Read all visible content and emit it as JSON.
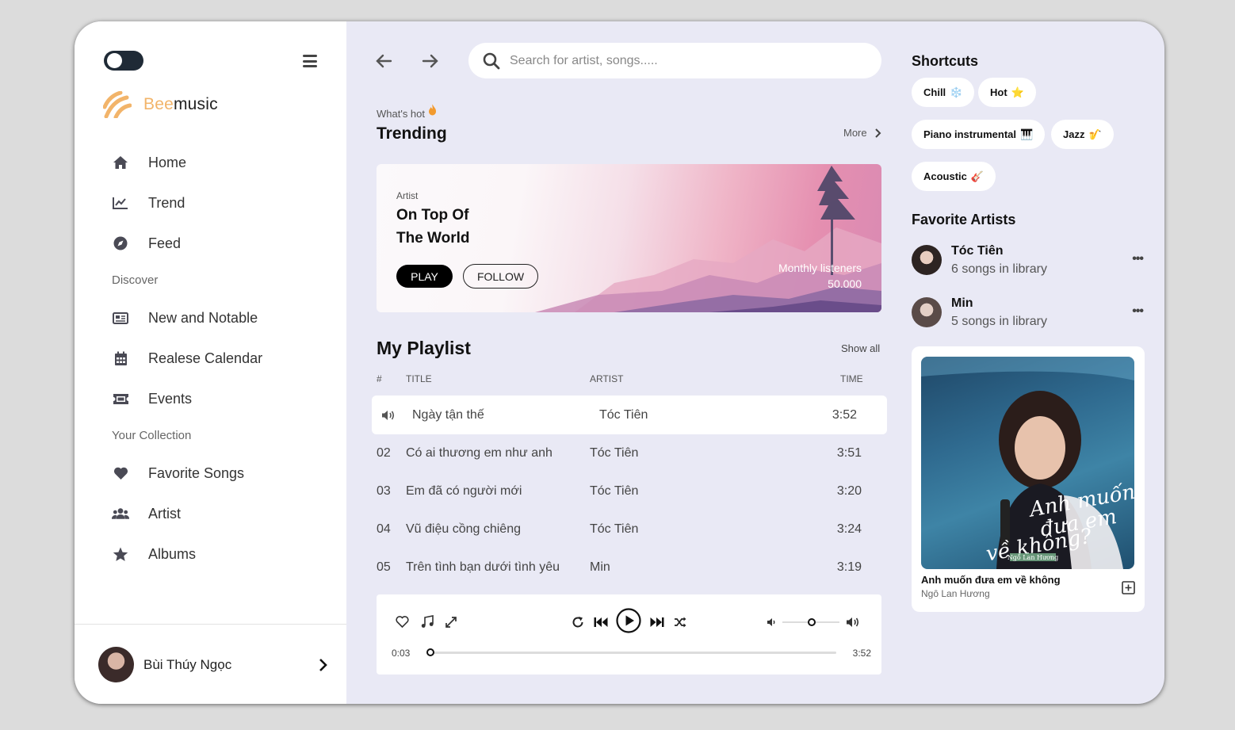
{
  "sidebar": {
    "logo": {
      "bee": "Bee",
      "music": "music"
    },
    "nav": [
      {
        "label": "Home",
        "icon": "home-icon"
      },
      {
        "label": "Trend",
        "icon": "chart-line-icon"
      },
      {
        "label": "Feed",
        "icon": "compass-icon"
      }
    ],
    "discover_label": "Discover",
    "discover": [
      {
        "label": "New and Notable",
        "icon": "newspaper-icon"
      },
      {
        "label": "Realese Calendar",
        "icon": "calendar-icon"
      },
      {
        "label": "Events",
        "icon": "ticket-icon"
      }
    ],
    "collection_label": "Your Collection",
    "collection": [
      {
        "label": "Favorite Songs",
        "icon": "heart-icon"
      },
      {
        "label": "Artist",
        "icon": "users-icon"
      },
      {
        "label": "Albums",
        "icon": "star-icon"
      }
    ],
    "user": {
      "name": "Bùi Thúy Ngọc"
    }
  },
  "search": {
    "placeholder": "Search for artist, songs....."
  },
  "trending": {
    "kicker": "What's hot",
    "title": "Trending",
    "more": "More",
    "hero": {
      "artist_label": "Artist",
      "title_line1": "On Top Of",
      "title_line2": "The World",
      "play": "PLAY",
      "follow": "FOLLOW",
      "listeners_label": "Monthly listeners",
      "listeners_value": "50.000"
    }
  },
  "playlist": {
    "title": "My Playlist",
    "show_all": "Show all",
    "headers": {
      "num": "#",
      "title": "TITLE",
      "artist": "ARTIST",
      "time": "TIME"
    },
    "rows": [
      {
        "num": "",
        "title": "Ngày tận thế",
        "artist": "Tóc Tiên",
        "time": "3:52",
        "playing": true
      },
      {
        "num": "02",
        "title": "Có ai thương em như anh",
        "artist": "Tóc Tiên",
        "time": "3:51"
      },
      {
        "num": "03",
        "title": "Em đã có người mới",
        "artist": "Tóc Tiên",
        "time": "3:20"
      },
      {
        "num": "04",
        "title": "Vũ điệu cồng chiêng",
        "artist": "Tóc Tiên",
        "time": "3:24"
      },
      {
        "num": "05",
        "title": "Trên tình bạn dưới tình yêu",
        "artist": "Min",
        "time": "3:19"
      }
    ]
  },
  "player": {
    "current": "0:03",
    "total": "3:52",
    "progress": 0.0,
    "volume": 0.52
  },
  "shortcuts": {
    "title": "Shortcuts",
    "chips": [
      {
        "label": "Chill",
        "emoji": "❄️"
      },
      {
        "label": "Hot",
        "emoji": "⭐"
      },
      {
        "label": "Piano instrumental",
        "emoji": "🎹"
      },
      {
        "label": "Jazz",
        "emoji": "🎷"
      },
      {
        "label": "Acoustic",
        "emoji": "🎸"
      }
    ]
  },
  "favorite_artists": {
    "title": "Favorite Artists",
    "items": [
      {
        "name": "Tóc Tiên",
        "sub": "6 songs in library"
      },
      {
        "name": "Min",
        "sub": "5 songs in library"
      }
    ]
  },
  "now_card": {
    "cover_text_line1": "Anh muốn",
    "cover_text_line2": "đưa em",
    "cover_text_line3": "về không?",
    "cover_artist": "Ngô Lan Hương",
    "song": "Anh muốn đưa em về không",
    "artist": "Ngô Lan Hương"
  },
  "colors": {
    "accent": "#f2b46a",
    "bg": "#e9e9f5",
    "dark": "#1f2a36"
  }
}
